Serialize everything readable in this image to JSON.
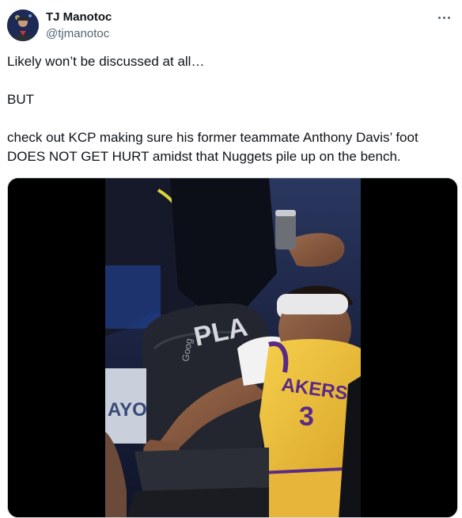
{
  "author": {
    "name": "TJ Manotoc",
    "handle": "@tjmanotoc",
    "avatar_icon": "profile-photo"
  },
  "more_icon": "more-horizontal-icon",
  "tweet": {
    "paragraphs": [
      "Likely won’t be discussed at all…",
      "BUT",
      "check out KCP making sure his former teammate Anthony Davis’ foot DOES NOT GET HURT amidst that Nuggets pile up on the bench."
    ]
  },
  "media": {
    "jersey_text": "AKERS",
    "jersey_number": "3",
    "chair_text": "PLA",
    "banner_text": "AYO",
    "sponsor_text": "Goog",
    "colors": {
      "jersey_gold": "#f2c43a",
      "jersey_purple": "#5b2a86",
      "court_blue": "#1f3f8a"
    }
  }
}
